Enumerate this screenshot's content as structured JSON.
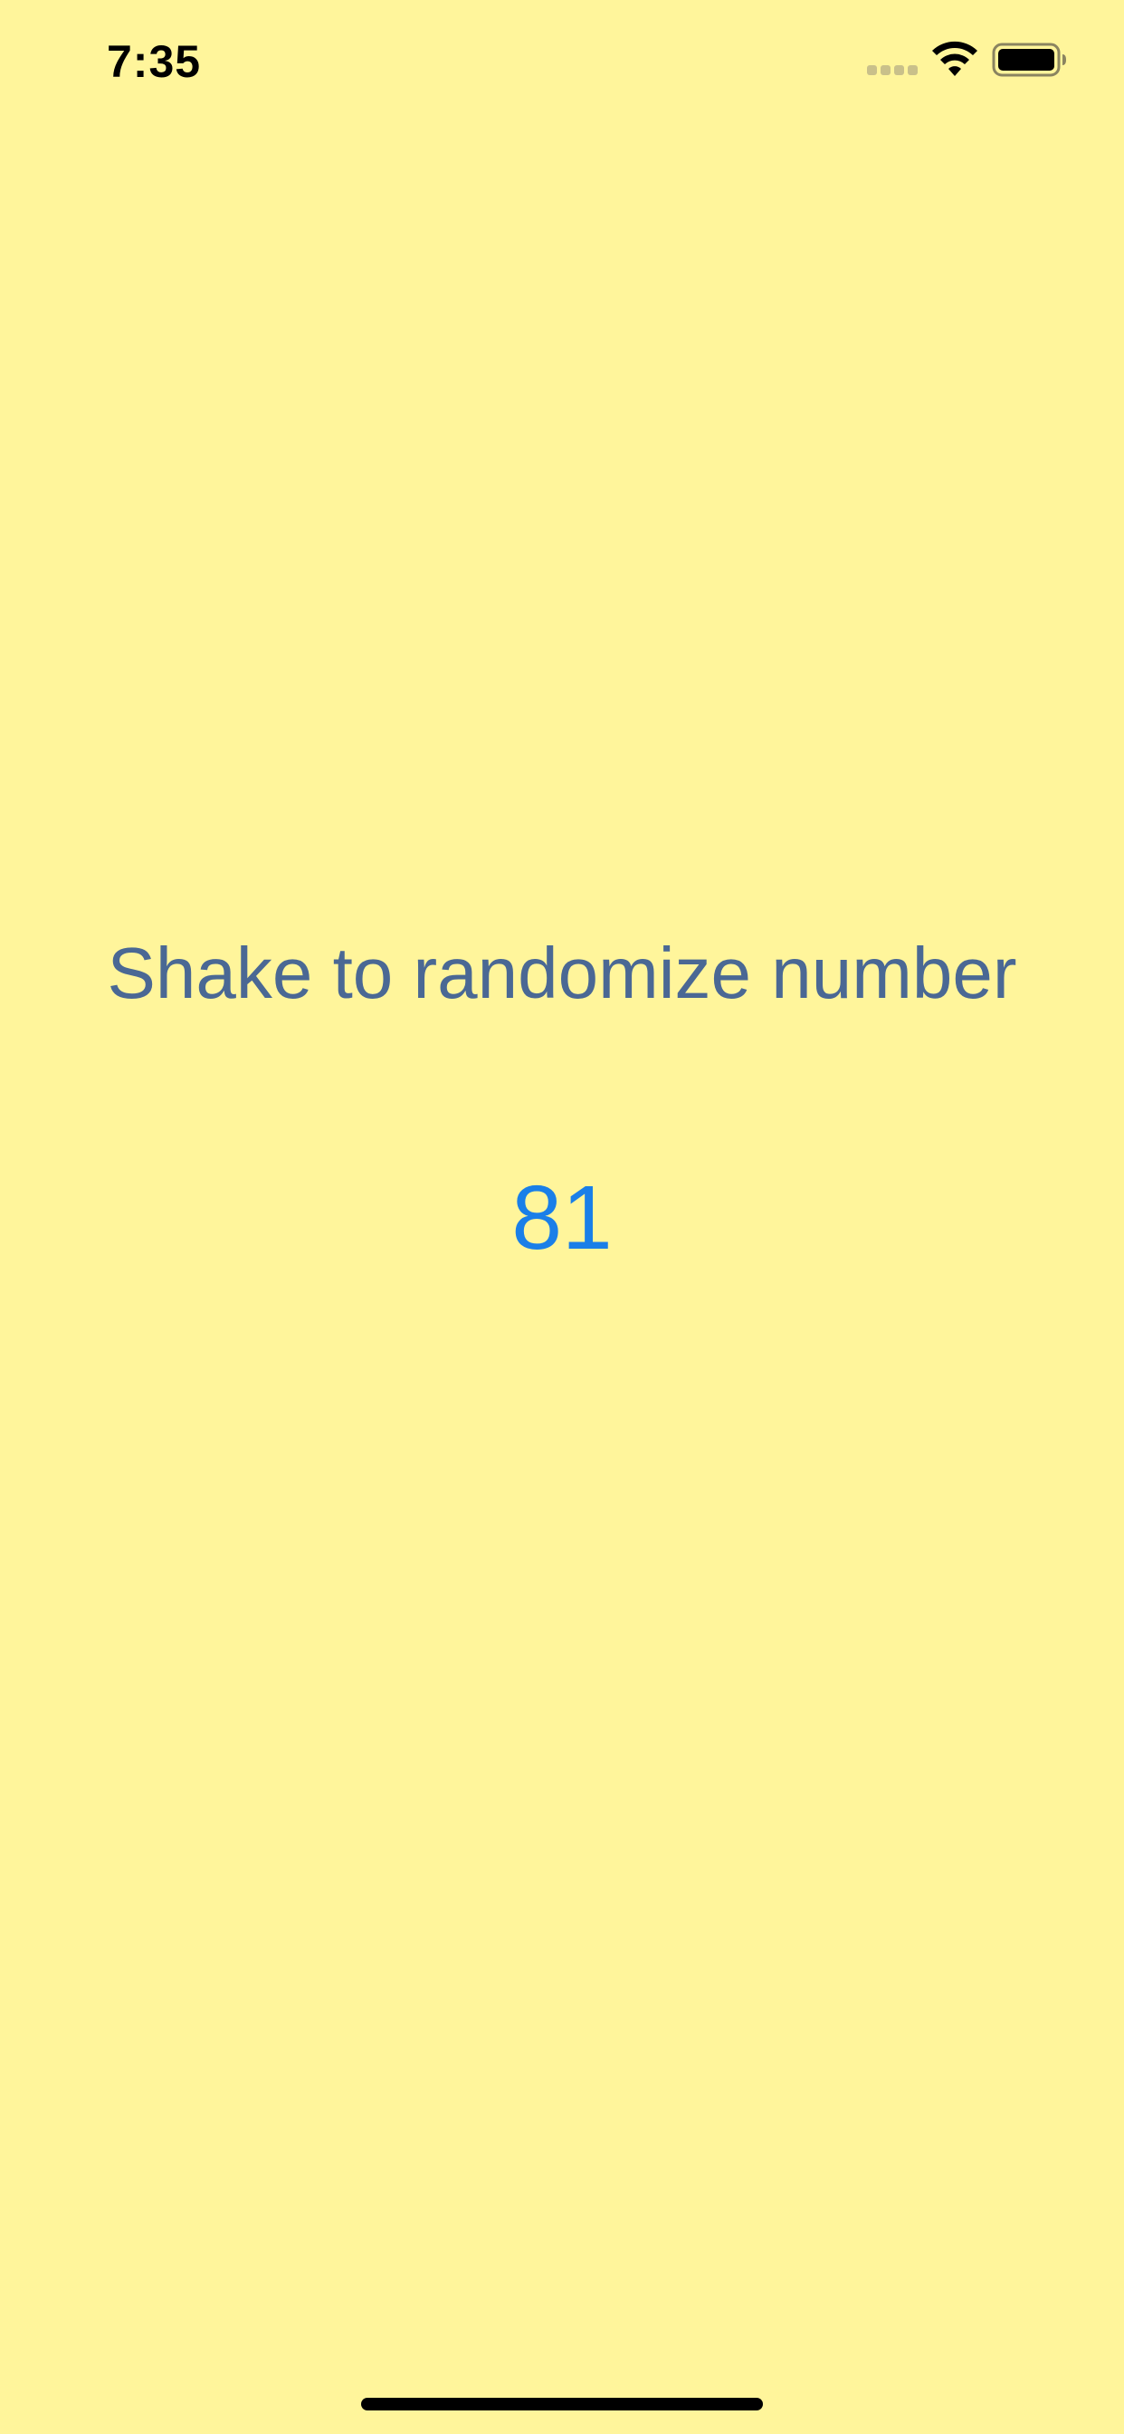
{
  "status_bar": {
    "time": "7:35",
    "icons": [
      "signal-dots-icon",
      "wifi-icon",
      "battery-icon"
    ]
  },
  "main": {
    "prompt": "Shake to randomize number",
    "number": "81"
  },
  "colors": {
    "background": "#FFF59B",
    "prompt_text": "#4A6894",
    "number_text": "#1A7FE8",
    "status_text": "#000000"
  }
}
